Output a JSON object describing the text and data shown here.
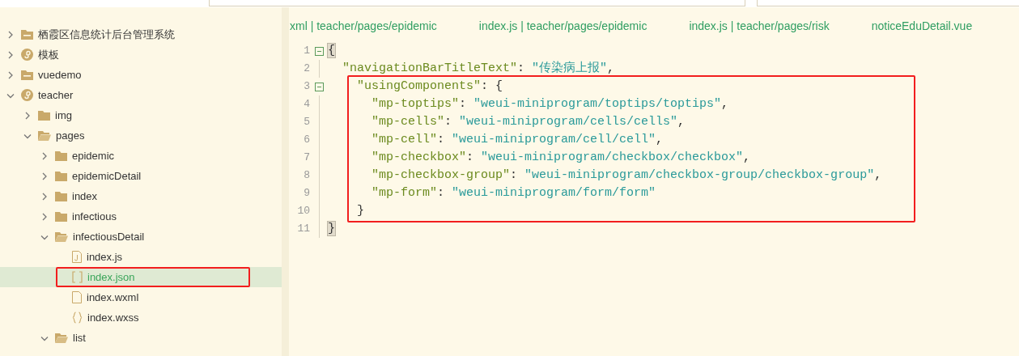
{
  "tree": [
    {
      "label": "栖霞区信息统计后台管理系统",
      "kind": "workspace-folder",
      "expanded": false,
      "selected": false
    },
    {
      "label": "模板",
      "kind": "miniapp",
      "expanded": false,
      "selected": false
    },
    {
      "label": "vuedemo",
      "kind": "workspace-folder",
      "expanded": false,
      "selected": false
    },
    {
      "label": "teacher",
      "kind": "miniapp",
      "expanded": true,
      "selected": false,
      "children": [
        {
          "label": "img",
          "kind": "folder",
          "expanded": false,
          "selected": false
        },
        {
          "label": "pages",
          "kind": "folder",
          "expanded": true,
          "selected": false,
          "children": [
            {
              "label": "epidemic",
              "kind": "folder",
              "expanded": false,
              "selected": false
            },
            {
              "label": "epidemicDetail",
              "kind": "folder",
              "expanded": false,
              "selected": false
            },
            {
              "label": "index",
              "kind": "folder",
              "expanded": false,
              "selected": false
            },
            {
              "label": "infectious",
              "kind": "folder",
              "expanded": false,
              "selected": false
            },
            {
              "label": "infectiousDetail",
              "kind": "folder",
              "expanded": true,
              "selected": false,
              "children": [
                {
                  "label": "index.js",
                  "kind": "file-js",
                  "selected": false,
                  "annotated": false
                },
                {
                  "label": "index.json",
                  "kind": "file-json",
                  "selected": true,
                  "annotated": true
                },
                {
                  "label": "index.wxml",
                  "kind": "file-wxml",
                  "selected": false,
                  "annotated": false
                },
                {
                  "label": "index.wxss",
                  "kind": "file-wxss",
                  "selected": false,
                  "annotated": false
                }
              ]
            },
            {
              "label": "list",
              "kind": "folder",
              "expanded": true,
              "selected": false
            }
          ]
        }
      ]
    }
  ],
  "tabs": [
    {
      "label": "xml | teacher/pages/epidemic"
    },
    {
      "label": "index.js | teacher/pages/epidemic"
    },
    {
      "label": "index.js | teacher/pages/risk"
    },
    {
      "label": "noticeEduDetail.vue"
    }
  ],
  "code": [
    {
      "annotated": false,
      "lines": [
        {
          "number": "1",
          "foldable": true,
          "tokens": [
            {
              "text": "{",
              "kind": "punct",
              "matched": true
            }
          ]
        },
        {
          "number": "2",
          "foldable": false,
          "tokens": [
            {
              "text": "  \"navigationBarTitleText\"",
              "kind": "key"
            },
            {
              "text": ": ",
              "kind": "punct"
            },
            {
              "text": "\"传染病上报\"",
              "kind": "string"
            },
            {
              "text": ",",
              "kind": "punct"
            }
          ]
        }
      ]
    },
    {
      "annotated": true,
      "lines": [
        {
          "number": "3",
          "foldable": true,
          "tokens": [
            {
              "text": "    \"usingComponents\"",
              "kind": "key"
            },
            {
              "text": ": {",
              "kind": "punct"
            }
          ]
        },
        {
          "number": "4",
          "foldable": false,
          "tokens": [
            {
              "text": "      \"mp-toptips\"",
              "kind": "key"
            },
            {
              "text": ": ",
              "kind": "punct"
            },
            {
              "text": "\"weui-miniprogram/toptips/toptips\"",
              "kind": "string"
            },
            {
              "text": ",",
              "kind": "punct"
            }
          ]
        },
        {
          "number": "5",
          "foldable": false,
          "tokens": [
            {
              "text": "      \"mp-cells\"",
              "kind": "key"
            },
            {
              "text": ": ",
              "kind": "punct"
            },
            {
              "text": "\"weui-miniprogram/cells/cells\"",
              "kind": "string"
            },
            {
              "text": ",",
              "kind": "punct"
            }
          ]
        },
        {
          "number": "6",
          "foldable": false,
          "tokens": [
            {
              "text": "      \"mp-cell\"",
              "kind": "key"
            },
            {
              "text": ": ",
              "kind": "punct"
            },
            {
              "text": "\"weui-miniprogram/cell/cell\"",
              "kind": "string"
            },
            {
              "text": ",",
              "kind": "punct"
            }
          ]
        },
        {
          "number": "7",
          "foldable": false,
          "tokens": [
            {
              "text": "      \"mp-checkbox\"",
              "kind": "key"
            },
            {
              "text": ": ",
              "kind": "punct"
            },
            {
              "text": "\"weui-miniprogram/checkbox/checkbox\"",
              "kind": "string"
            },
            {
              "text": ",",
              "kind": "punct"
            }
          ]
        },
        {
          "number": "8",
          "foldable": false,
          "tokens": [
            {
              "text": "      \"mp-checkbox-group\"",
              "kind": "key"
            },
            {
              "text": ": ",
              "kind": "punct"
            },
            {
              "text": "\"weui-miniprogram/checkbox-group/checkbox-group\"",
              "kind": "string"
            },
            {
              "text": ",",
              "kind": "punct"
            }
          ]
        },
        {
          "number": "9",
          "foldable": false,
          "tokens": [
            {
              "text": "      \"mp-form\"",
              "kind": "key"
            },
            {
              "text": ": ",
              "kind": "punct"
            },
            {
              "text": "\"weui-miniprogram/form/form\"",
              "kind": "string"
            }
          ]
        },
        {
          "number": "10",
          "foldable": false,
          "tokens": [
            {
              "text": "    }",
              "kind": "punct"
            }
          ]
        }
      ]
    },
    {
      "annotated": false,
      "lines": [
        {
          "number": "11",
          "foldable": false,
          "tokens": [
            {
              "text": "}",
              "kind": "punct",
              "matched": true
            }
          ]
        }
      ]
    }
  ]
}
